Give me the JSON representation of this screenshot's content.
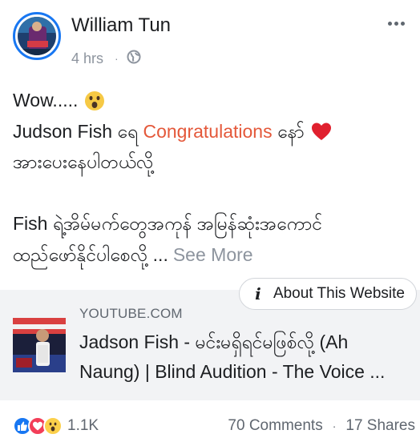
{
  "post": {
    "author": "William Tun",
    "time": "4 hrs",
    "privacy_icon": "globe-icon",
    "menu_icon": "more-horizontal-icon",
    "text": {
      "line1": "Wow.....",
      "line2_before": "Judson Fish ရေ ",
      "line2_highlight": "Congratulations",
      "line2_after": " နော်",
      "line3": "အားပေးနေပါတယ်လို့",
      "line5": "Fish ရဲ့အိမ်မက်တွေအကုန် အမြန်ဆုံးအကောင်",
      "line6": "ထည်ဖော်နိုင်ပါစေလို့ ...",
      "see_more": "See More"
    },
    "emojis": [
      "surprised-face",
      "red-heart"
    ]
  },
  "link_preview": {
    "about_label": "About This Website",
    "domain": "YOUTUBE.COM",
    "title_line1": "Jadson Fish - မင်းမရှိရင်မဖြစ်လို့ (Ah",
    "title_line2": "Naung) | Blind Audition - The Voice ..."
  },
  "footer": {
    "reactions": [
      "like",
      "love",
      "wow"
    ],
    "reaction_count": "1.1K",
    "comments": "70 Comments",
    "shares": "17 Shares"
  },
  "colors": {
    "accent": "#e4583a",
    "link_bg": "#f2f3f5",
    "avatar_ring": "#1877f2",
    "secondary_text": "#8d949e"
  }
}
